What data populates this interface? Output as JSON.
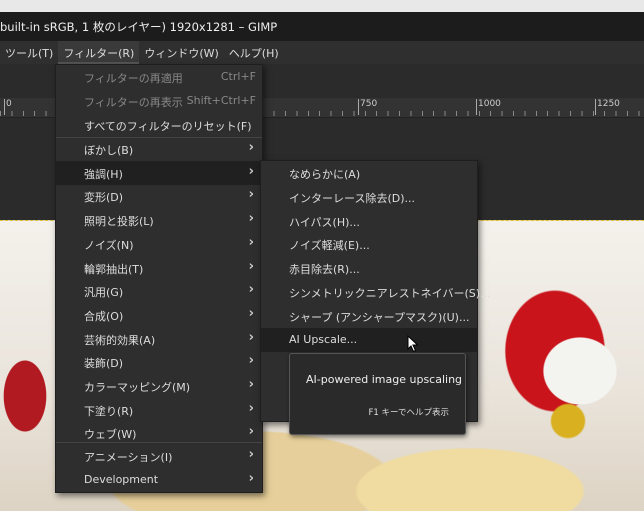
{
  "window": {
    "title": "built-in sRGB, 1 枚のレイヤー) 1920x1281 – GIMP"
  },
  "menubar": [
    {
      "label": "ツール(T)"
    },
    {
      "label": "フィルター(R)"
    },
    {
      "label": "ウィンドウ(W)"
    },
    {
      "label": "ヘルプ(H)"
    }
  ],
  "ruler": {
    "labels": [
      "0",
      "750",
      "1000",
      "1250"
    ]
  },
  "filter_menu": {
    "top_items": [
      {
        "label": "フィルターの再適用",
        "shortcut": "Ctrl+F"
      },
      {
        "label": "フィルターの再表示",
        "shortcut": "Shift+Ctrl+F"
      },
      {
        "label": "すべてのフィルターのリセット(F)"
      }
    ],
    "items": [
      {
        "label": "ぼかし(B)"
      },
      {
        "label": "強調(H)"
      },
      {
        "label": "変形(D)"
      },
      {
        "label": "照明と投影(L)"
      },
      {
        "label": "ノイズ(N)"
      },
      {
        "label": "輪郭抽出(T)"
      },
      {
        "label": "汎用(G)"
      },
      {
        "label": "合成(O)"
      },
      {
        "label": "芸術的効果(A)"
      },
      {
        "label": "装飾(D)"
      },
      {
        "label": "カラーマッピング(M)"
      },
      {
        "label": "下塗り(R)"
      },
      {
        "label": "ウェブ(W)"
      }
    ],
    "bottom_items": [
      {
        "label": "アニメーション(I)"
      },
      {
        "label": "Development"
      }
    ]
  },
  "enhance_submenu": [
    {
      "label": "なめらかに(A)"
    },
    {
      "label": "インターレース除去(D)..."
    },
    {
      "label": "ハイパス(H)..."
    },
    {
      "label": "ノイズ軽減(E)..."
    },
    {
      "label": "赤目除去(R)..."
    },
    {
      "label": "シンメトリックニアレストネイバー(S)..."
    },
    {
      "label": "シャープ (アンシャープマスク)(U)..."
    },
    {
      "label": "AI Upscale..."
    }
  ],
  "tooltip": {
    "text": "AI-powered image upscaling",
    "help": "F1 キーでヘルプ表示"
  }
}
